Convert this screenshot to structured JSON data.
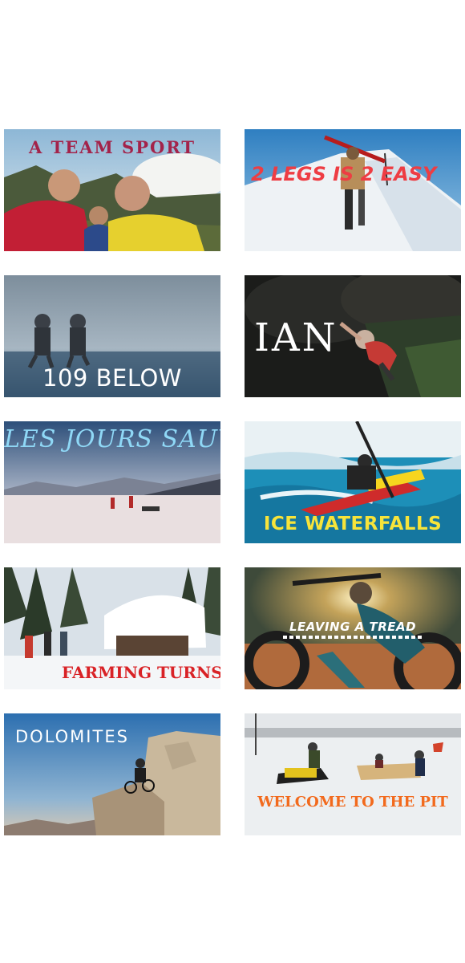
{
  "films": [
    {
      "title": "A TEAM SPORT"
    },
    {
      "title": "2 LEGS IS 2 EASY"
    },
    {
      "title": "109 BELOW"
    },
    {
      "title": "IAN"
    },
    {
      "title": "LES JOURS SAUVAGES"
    },
    {
      "title": "ICE WATERFALLS"
    },
    {
      "title": "FARMING TURNS"
    },
    {
      "title": "LEAVING A TREAD"
    },
    {
      "title": "DOLOMITES"
    },
    {
      "title": "WELCOME TO THE PIT"
    }
  ],
  "colors": {
    "page_background": "#ffffff",
    "team_sport_title": "#a3234a",
    "two_legs_title": "#ee3d43",
    "below_title": "#ffffff",
    "ian_title": "#ffffff",
    "jours_title": "#8fd8f6",
    "ice_title": "#f7e43a",
    "farming_title": "#d92226",
    "tread_title": "#ffffff",
    "dolomites_title": "#ffffff",
    "pit_title": "#f26a1d"
  }
}
